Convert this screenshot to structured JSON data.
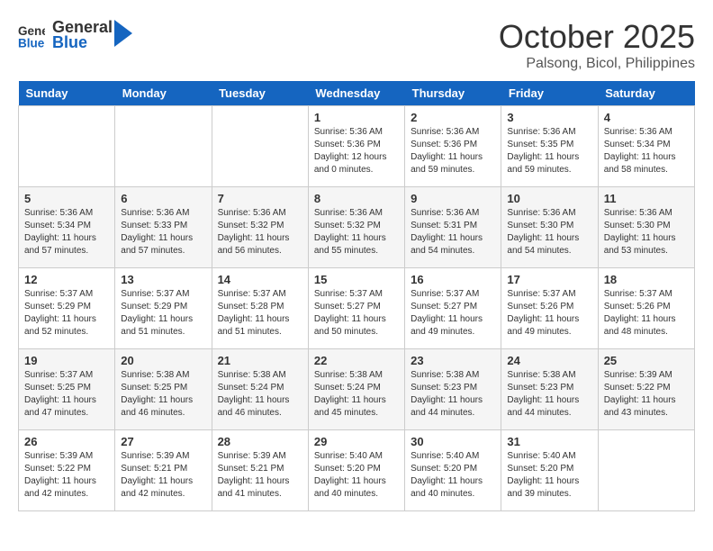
{
  "header": {
    "logo_line1": "General",
    "logo_line2": "Blue",
    "month_title": "October 2025",
    "subtitle": "Palsong, Bicol, Philippines"
  },
  "weekdays": [
    "Sunday",
    "Monday",
    "Tuesday",
    "Wednesday",
    "Thursday",
    "Friday",
    "Saturday"
  ],
  "weeks": [
    [
      {
        "day": "",
        "sunrise": "",
        "sunset": "",
        "daylight": ""
      },
      {
        "day": "",
        "sunrise": "",
        "sunset": "",
        "daylight": ""
      },
      {
        "day": "",
        "sunrise": "",
        "sunset": "",
        "daylight": ""
      },
      {
        "day": "1",
        "sunrise": "Sunrise: 5:36 AM",
        "sunset": "Sunset: 5:36 PM",
        "daylight": "Daylight: 12 hours and 0 minutes."
      },
      {
        "day": "2",
        "sunrise": "Sunrise: 5:36 AM",
        "sunset": "Sunset: 5:36 PM",
        "daylight": "Daylight: 11 hours and 59 minutes."
      },
      {
        "day": "3",
        "sunrise": "Sunrise: 5:36 AM",
        "sunset": "Sunset: 5:35 PM",
        "daylight": "Daylight: 11 hours and 59 minutes."
      },
      {
        "day": "4",
        "sunrise": "Sunrise: 5:36 AM",
        "sunset": "Sunset: 5:34 PM",
        "daylight": "Daylight: 11 hours and 58 minutes."
      }
    ],
    [
      {
        "day": "5",
        "sunrise": "Sunrise: 5:36 AM",
        "sunset": "Sunset: 5:34 PM",
        "daylight": "Daylight: 11 hours and 57 minutes."
      },
      {
        "day": "6",
        "sunrise": "Sunrise: 5:36 AM",
        "sunset": "Sunset: 5:33 PM",
        "daylight": "Daylight: 11 hours and 57 minutes."
      },
      {
        "day": "7",
        "sunrise": "Sunrise: 5:36 AM",
        "sunset": "Sunset: 5:32 PM",
        "daylight": "Daylight: 11 hours and 56 minutes."
      },
      {
        "day": "8",
        "sunrise": "Sunrise: 5:36 AM",
        "sunset": "Sunset: 5:32 PM",
        "daylight": "Daylight: 11 hours and 55 minutes."
      },
      {
        "day": "9",
        "sunrise": "Sunrise: 5:36 AM",
        "sunset": "Sunset: 5:31 PM",
        "daylight": "Daylight: 11 hours and 54 minutes."
      },
      {
        "day": "10",
        "sunrise": "Sunrise: 5:36 AM",
        "sunset": "Sunset: 5:30 PM",
        "daylight": "Daylight: 11 hours and 54 minutes."
      },
      {
        "day": "11",
        "sunrise": "Sunrise: 5:36 AM",
        "sunset": "Sunset: 5:30 PM",
        "daylight": "Daylight: 11 hours and 53 minutes."
      }
    ],
    [
      {
        "day": "12",
        "sunrise": "Sunrise: 5:37 AM",
        "sunset": "Sunset: 5:29 PM",
        "daylight": "Daylight: 11 hours and 52 minutes."
      },
      {
        "day": "13",
        "sunrise": "Sunrise: 5:37 AM",
        "sunset": "Sunset: 5:29 PM",
        "daylight": "Daylight: 11 hours and 51 minutes."
      },
      {
        "day": "14",
        "sunrise": "Sunrise: 5:37 AM",
        "sunset": "Sunset: 5:28 PM",
        "daylight": "Daylight: 11 hours and 51 minutes."
      },
      {
        "day": "15",
        "sunrise": "Sunrise: 5:37 AM",
        "sunset": "Sunset: 5:27 PM",
        "daylight": "Daylight: 11 hours and 50 minutes."
      },
      {
        "day": "16",
        "sunrise": "Sunrise: 5:37 AM",
        "sunset": "Sunset: 5:27 PM",
        "daylight": "Daylight: 11 hours and 49 minutes."
      },
      {
        "day": "17",
        "sunrise": "Sunrise: 5:37 AM",
        "sunset": "Sunset: 5:26 PM",
        "daylight": "Daylight: 11 hours and 49 minutes."
      },
      {
        "day": "18",
        "sunrise": "Sunrise: 5:37 AM",
        "sunset": "Sunset: 5:26 PM",
        "daylight": "Daylight: 11 hours and 48 minutes."
      }
    ],
    [
      {
        "day": "19",
        "sunrise": "Sunrise: 5:37 AM",
        "sunset": "Sunset: 5:25 PM",
        "daylight": "Daylight: 11 hours and 47 minutes."
      },
      {
        "day": "20",
        "sunrise": "Sunrise: 5:38 AM",
        "sunset": "Sunset: 5:25 PM",
        "daylight": "Daylight: 11 hours and 46 minutes."
      },
      {
        "day": "21",
        "sunrise": "Sunrise: 5:38 AM",
        "sunset": "Sunset: 5:24 PM",
        "daylight": "Daylight: 11 hours and 46 minutes."
      },
      {
        "day": "22",
        "sunrise": "Sunrise: 5:38 AM",
        "sunset": "Sunset: 5:24 PM",
        "daylight": "Daylight: 11 hours and 45 minutes."
      },
      {
        "day": "23",
        "sunrise": "Sunrise: 5:38 AM",
        "sunset": "Sunset: 5:23 PM",
        "daylight": "Daylight: 11 hours and 44 minutes."
      },
      {
        "day": "24",
        "sunrise": "Sunrise: 5:38 AM",
        "sunset": "Sunset: 5:23 PM",
        "daylight": "Daylight: 11 hours and 44 minutes."
      },
      {
        "day": "25",
        "sunrise": "Sunrise: 5:39 AM",
        "sunset": "Sunset: 5:22 PM",
        "daylight": "Daylight: 11 hours and 43 minutes."
      }
    ],
    [
      {
        "day": "26",
        "sunrise": "Sunrise: 5:39 AM",
        "sunset": "Sunset: 5:22 PM",
        "daylight": "Daylight: 11 hours and 42 minutes."
      },
      {
        "day": "27",
        "sunrise": "Sunrise: 5:39 AM",
        "sunset": "Sunset: 5:21 PM",
        "daylight": "Daylight: 11 hours and 42 minutes."
      },
      {
        "day": "28",
        "sunrise": "Sunrise: 5:39 AM",
        "sunset": "Sunset: 5:21 PM",
        "daylight": "Daylight: 11 hours and 41 minutes."
      },
      {
        "day": "29",
        "sunrise": "Sunrise: 5:40 AM",
        "sunset": "Sunset: 5:20 PM",
        "daylight": "Daylight: 11 hours and 40 minutes."
      },
      {
        "day": "30",
        "sunrise": "Sunrise: 5:40 AM",
        "sunset": "Sunset: 5:20 PM",
        "daylight": "Daylight: 11 hours and 40 minutes."
      },
      {
        "day": "31",
        "sunrise": "Sunrise: 5:40 AM",
        "sunset": "Sunset: 5:20 PM",
        "daylight": "Daylight: 11 hours and 39 minutes."
      },
      {
        "day": "",
        "sunrise": "",
        "sunset": "",
        "daylight": ""
      }
    ]
  ]
}
